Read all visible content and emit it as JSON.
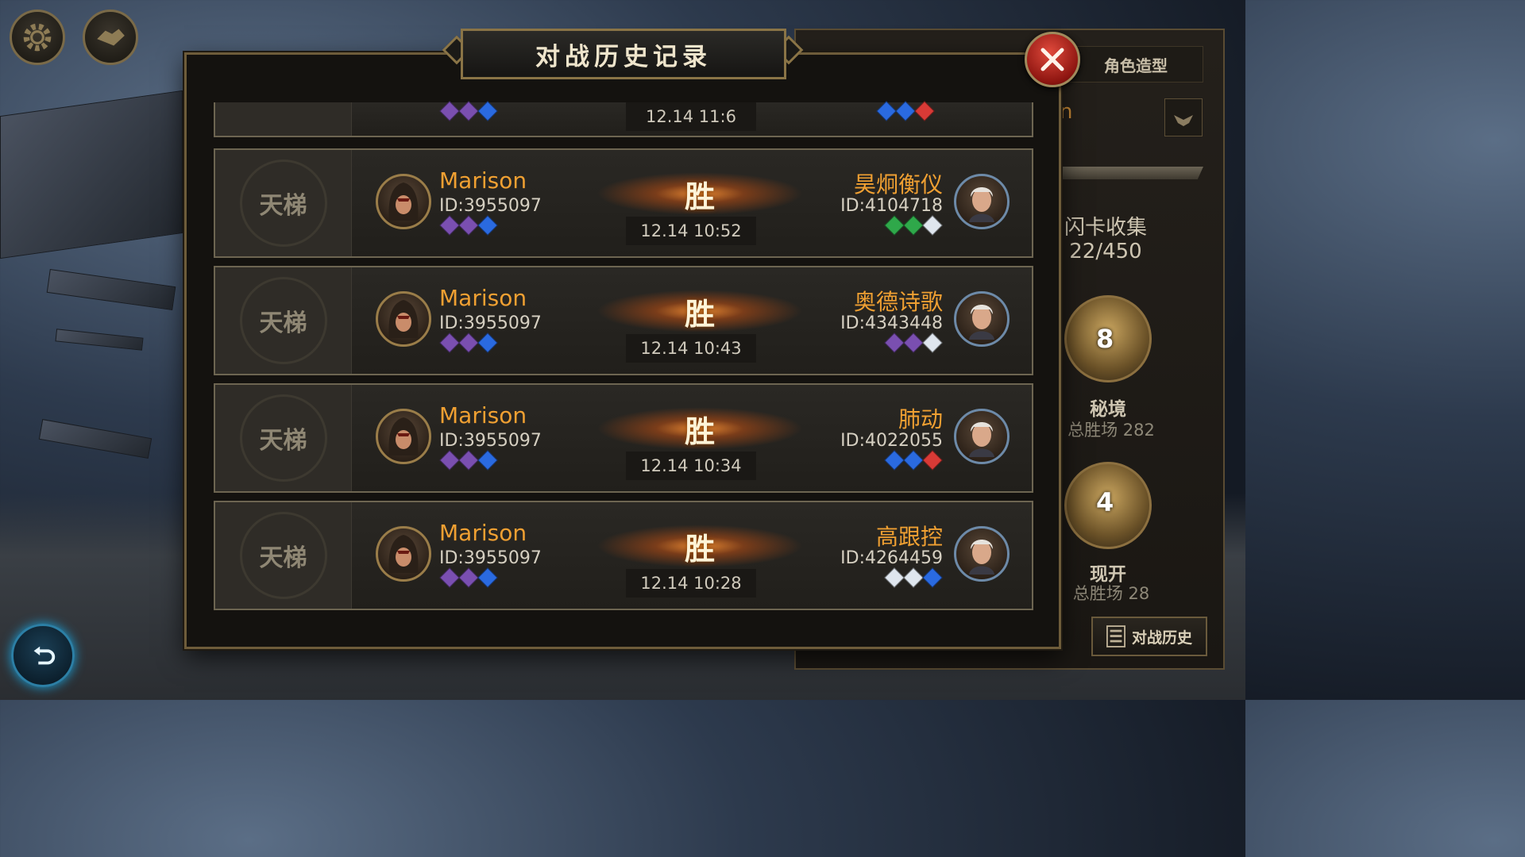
{
  "modal": {
    "title": "对战历史记录",
    "close_icon": "close-x-icon"
  },
  "toolbar": {
    "settings_icon": "gear-icon",
    "handshake_icon": "handshake-icon",
    "back_icon": "back-arrow-icon"
  },
  "partial_record": {
    "time": "12.14 11:6",
    "left_gems": [
      "#7a4fb0",
      "#7a4fb0",
      "#2a6ae0"
    ],
    "right_gems": [
      "#2a6ae0",
      "#2a6ae0",
      "#d83a36"
    ]
  },
  "records": [
    {
      "mode": "天梯",
      "player_name": "Marison",
      "player_id": "ID:3955097",
      "player_gems": [
        "#7a4fb0",
        "#7a4fb0",
        "#2a6ae0"
      ],
      "result": "胜",
      "time": "12.14 10:52",
      "opponent_name": "昊炯衡仪",
      "opponent_id": "ID:4104718",
      "opponent_gems": [
        "#2fa84a",
        "#2fa84a",
        "#dfe6ee"
      ]
    },
    {
      "mode": "天梯",
      "player_name": "Marison",
      "player_id": "ID:3955097",
      "player_gems": [
        "#7a4fb0",
        "#7a4fb0",
        "#2a6ae0"
      ],
      "result": "胜",
      "time": "12.14 10:43",
      "opponent_name": "奥德诗歌",
      "opponent_id": "ID:4343448",
      "opponent_gems": [
        "#7a4fb0",
        "#7a4fb0",
        "#dfe6ee"
      ]
    },
    {
      "mode": "天梯",
      "player_name": "Marison",
      "player_id": "ID:3955097",
      "player_gems": [
        "#7a4fb0",
        "#7a4fb0",
        "#2a6ae0"
      ],
      "result": "胜",
      "time": "12.14 10:34",
      "opponent_name": "肺动",
      "opponent_id": "ID:4022055",
      "opponent_gems": [
        "#2a6ae0",
        "#2a6ae0",
        "#d83a36"
      ]
    },
    {
      "mode": "天梯",
      "player_name": "Marison",
      "player_id": "ID:3955097",
      "player_gems": [
        "#7a4fb0",
        "#7a4fb0",
        "#2a6ae0"
      ],
      "result": "胜",
      "time": "12.14 10:28",
      "opponent_name": "高跟控",
      "opponent_id": "ID:4264459",
      "opponent_gems": [
        "#dfe6ee",
        "#dfe6ee",
        "#2a6ae0"
      ]
    }
  ],
  "side_panel": {
    "tab_label": "角色造型",
    "partial_letter": "n",
    "card_collection_label": "闪卡收集",
    "card_collection_value": "22/450",
    "secret_rank": "8",
    "secret_label": "秘境",
    "secret_wins": "总胜场 282",
    "realm_rank": "4",
    "realm_label": "现开",
    "realm_wins": "总胜场 28",
    "history_button": "对战历史"
  },
  "colors": {
    "accent_gold": "#8a7446",
    "name_orange": "#f0a032",
    "win_glow": "#e08a30"
  }
}
